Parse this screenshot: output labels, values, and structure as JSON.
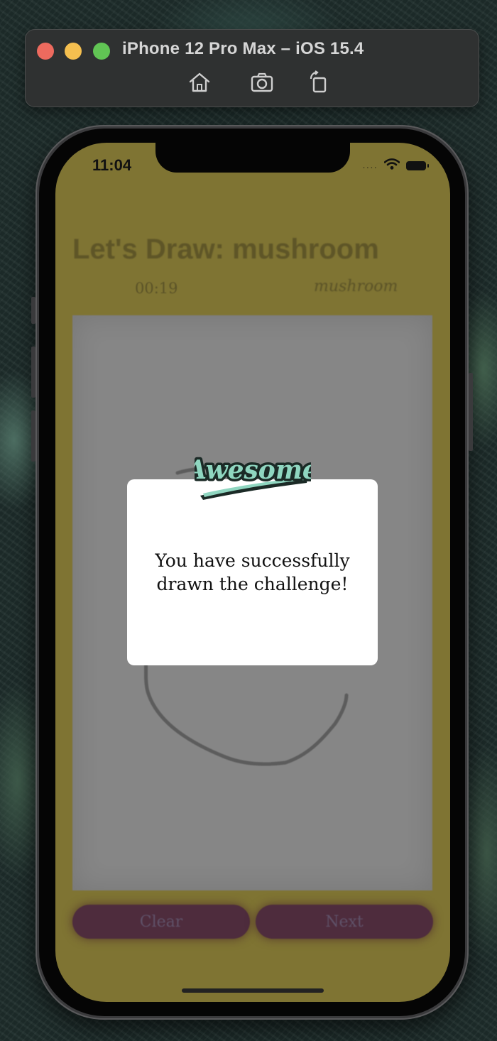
{
  "simulator": {
    "title": "iPhone 12 Pro Max – iOS 15.4",
    "toolbar": [
      {
        "name": "home",
        "icon": "home-icon"
      },
      {
        "name": "screenshot",
        "icon": "camera-icon"
      },
      {
        "name": "rotate",
        "icon": "rotate-icon"
      }
    ]
  },
  "status_bar": {
    "time": "11:04",
    "signal_dots": "....",
    "icons": [
      "wifi-icon",
      "battery-icon"
    ]
  },
  "app": {
    "heading": "Let's Draw: mushroom",
    "timer": "00:19",
    "prediction": "mushroom",
    "canvas_color": "#868686",
    "buttons": {
      "clear": "Clear",
      "next": "Next"
    }
  },
  "popup": {
    "badge_text": "Awesome",
    "message": "You have successfully drawn the challenge!"
  },
  "colors": {
    "screen_bg": "#7f7433",
    "button_bg": "#4e2c3d",
    "badge_teal": "#8fd6c0"
  }
}
